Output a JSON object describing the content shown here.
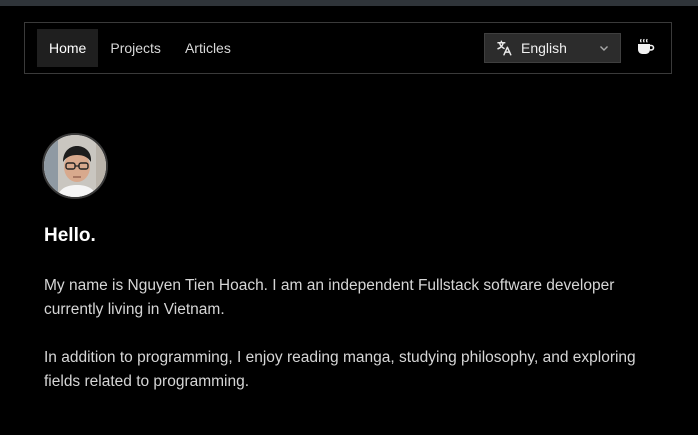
{
  "nav": {
    "links": [
      {
        "label": "Home",
        "active": true
      },
      {
        "label": "Projects",
        "active": false
      },
      {
        "label": "Articles",
        "active": false
      }
    ],
    "language": {
      "selected": "English",
      "icon": "translate-icon",
      "dropdown_icon": "chevron-down-icon"
    },
    "theme_icon": "coffee-cup-icon"
  },
  "hero": {
    "greeting": "Hello.",
    "paragraphs": [
      "My name is Nguyen Tien Hoach. I am an independent Fullstack software developer currently living in Vietnam.",
      "In addition to programming, I enjoy reading manga, studying philosophy, and exploring fields related to programming."
    ]
  },
  "colors": {
    "background": "#000000",
    "topbar": "#2f3439",
    "select_bg": "#2c2c2c"
  }
}
